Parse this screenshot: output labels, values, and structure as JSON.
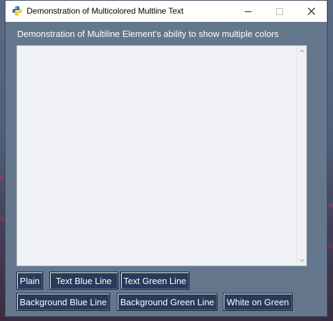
{
  "window": {
    "title": "Demonstration of Multicolored Multline Text",
    "app_icon": "python-icon",
    "controls": {
      "minimize_icon": "minimize-icon",
      "maximize_icon": "maximize-icon",
      "close_icon": "close-icon"
    }
  },
  "main": {
    "header_text": "Demonstration of Multiline Element's ability to show multiple colors",
    "multiline_value": ""
  },
  "buttons": {
    "row1": [
      "Plain",
      "Text Blue Line",
      "Text Green Line"
    ],
    "row2": [
      "Background Blue Line",
      "Background Green Line",
      "White on Green"
    ]
  },
  "colors": {
    "window_bg": "#64778d",
    "button_bg": "#283b5b",
    "button_text": "#ffffff",
    "multiline_bg": "#f0f2f7",
    "header_text": "#ffffff"
  }
}
